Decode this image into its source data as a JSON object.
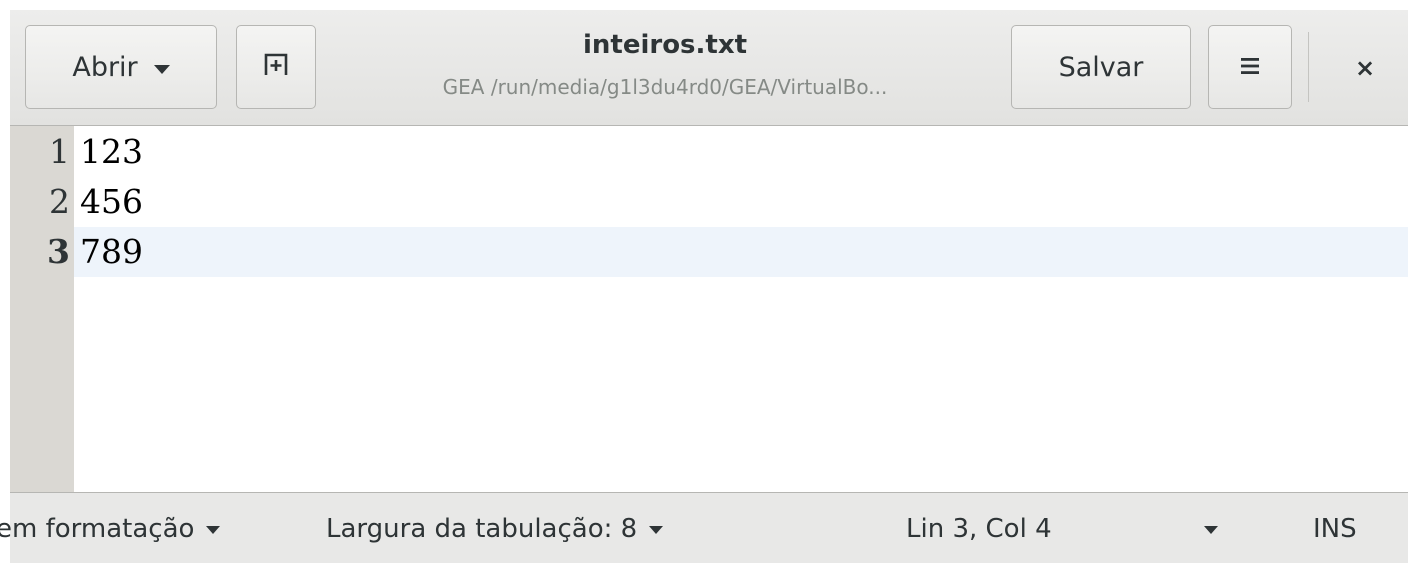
{
  "header": {
    "open_label": "Abrir",
    "save_label": "Salvar",
    "title": "inteiros.txt",
    "subtitle": "GEA /run/media/g1l3du4rd0/GEA/VirtualBo...",
    "close_glyph": "×"
  },
  "editor": {
    "lines": [
      {
        "num": "1",
        "text": "123"
      },
      {
        "num": "2",
        "text": "456"
      },
      {
        "num": "3",
        "text": "789"
      }
    ],
    "current_line": 3
  },
  "statusbar": {
    "language": "em formatação",
    "tab_width": "Largura da tabulação: 8",
    "position": "Lin 3, Col 4",
    "mode": "INS"
  },
  "colors": {
    "current_line_highlight": "#eef4fb",
    "gutter": "#dad8d3",
    "headerbar": "#e8e8e7"
  },
  "icons": {
    "open_dropdown": "chevron-down-icon",
    "new_tab": "new-tab-icon",
    "menu": "hamburger-menu-icon",
    "close": "close-icon"
  }
}
